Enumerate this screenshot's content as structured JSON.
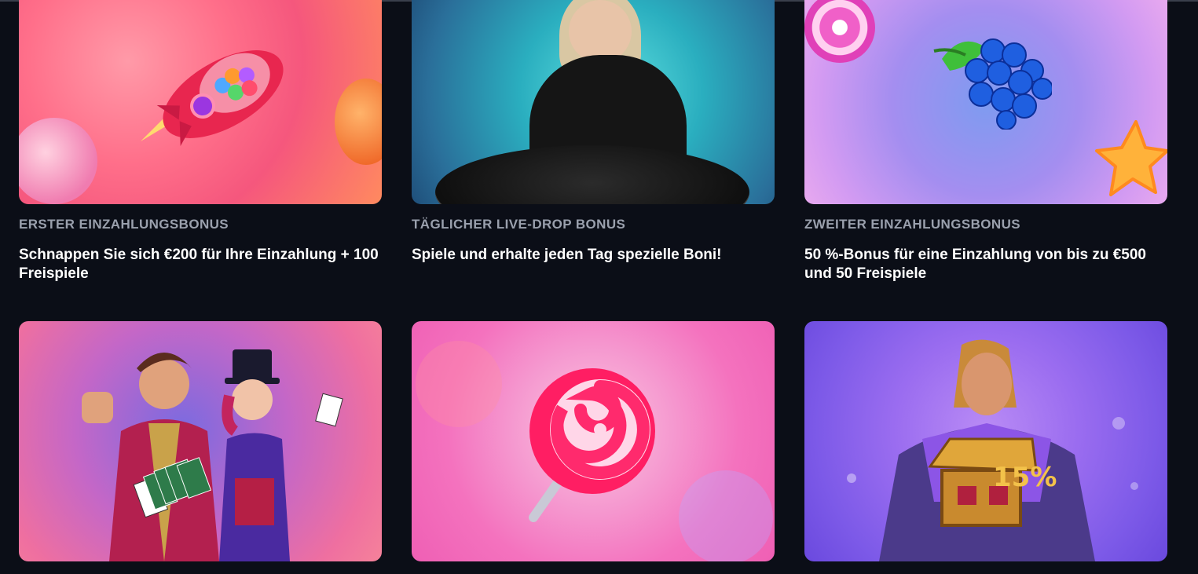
{
  "promotions": [
    {
      "category": "ERSTER EINZAHLUNGSBONUS",
      "headline": "Schnappen Sie sich €200 für Ihre Einzahlung + 100 Freispiele"
    },
    {
      "category": "TÄGLICHER LIVE-DROP BONUS",
      "headline": "Spiele und erhalte jeden Tag spezielle Boni!"
    },
    {
      "category": "ZWEITER EINZAHLUNGSBONUS",
      "headline": "50 %-Bonus für eine Einzahlung von bis zu €500 und 50 Freispiele"
    }
  ],
  "second_row_images": [
    {
      "icon": "magicians-image"
    },
    {
      "icon": "lollipop-image"
    },
    {
      "icon": "warrior-treasure-image"
    }
  ],
  "colors": {
    "background": "#0b0e17",
    "category_text": "#9aa0ad",
    "headline_text": "#ffffff"
  }
}
